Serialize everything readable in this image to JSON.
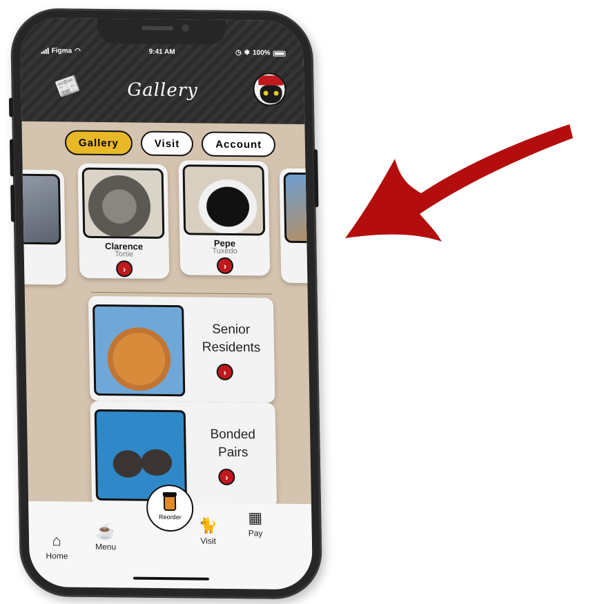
{
  "status_bar": {
    "carrier": "Figma",
    "time": "9:41 AM",
    "battery": "100%"
  },
  "header": {
    "title": "Gallery",
    "left_icon": "newspaper-icon",
    "right_icon": "cat-avatar"
  },
  "tabs": [
    {
      "label": "Gallery",
      "active": true
    },
    {
      "label": "Visit",
      "active": false
    },
    {
      "label": "Account",
      "active": false
    }
  ],
  "carousel": [
    {
      "name": "Clarence",
      "breed": "Tortie"
    },
    {
      "name": "Pepe",
      "breed": "Tuxedo"
    }
  ],
  "categories": [
    {
      "label_line1": "Senior",
      "label_line2": "Residents"
    },
    {
      "label_line1": "Bonded",
      "label_line2": "Pairs"
    }
  ],
  "bottom_nav": {
    "home": "Home",
    "menu": "Menu",
    "reorder": "Reorder",
    "visit": "Visit",
    "pay": "Pay"
  },
  "colors": {
    "accent": "#e8b829",
    "action_red": "#c0181c",
    "background": "#d4c3ae",
    "arrow": "#b30d0d"
  }
}
